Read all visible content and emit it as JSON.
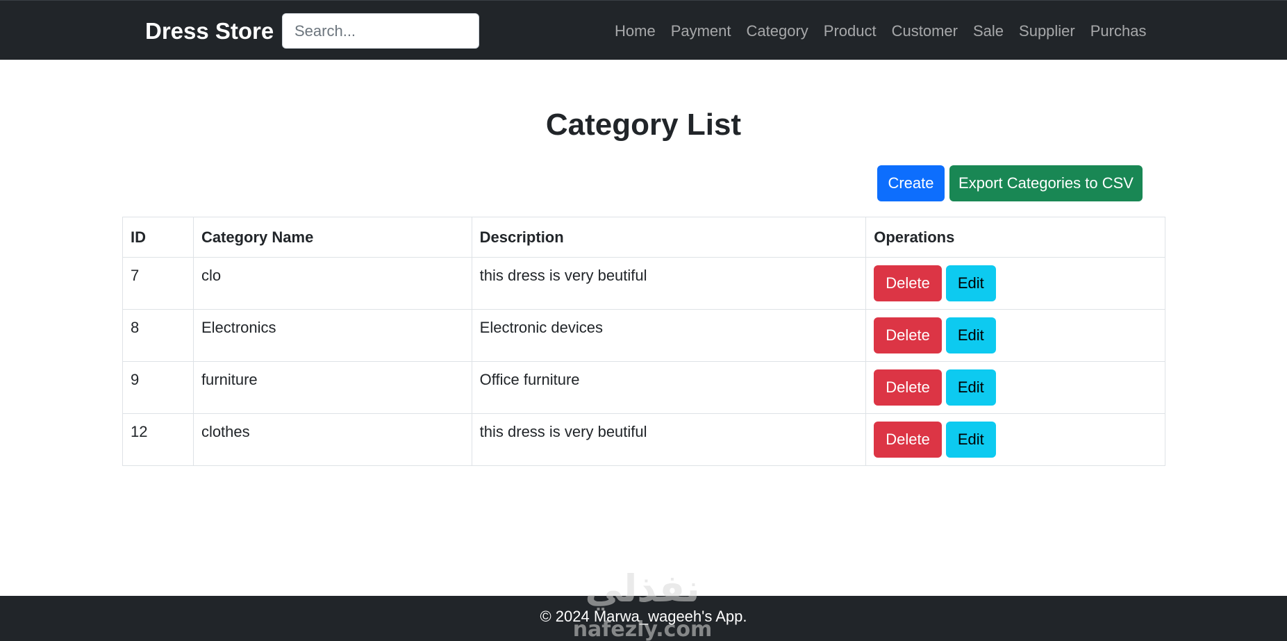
{
  "navbar": {
    "brand": "Dress Store",
    "search_placeholder": "Search...",
    "links": [
      "Home",
      "Payment",
      "Category",
      "Product",
      "Customer",
      "Sale",
      "Supplier",
      "Purchas"
    ]
  },
  "page": {
    "title": "Category List",
    "create_label": "Create",
    "export_label": "Export Categories to CSV"
  },
  "table": {
    "headers": [
      "ID",
      "Category Name",
      "Description",
      "Operations"
    ],
    "rows": [
      {
        "id": "7",
        "name": "clo",
        "description": "this dress is very beutiful"
      },
      {
        "id": "8",
        "name": "Electronics",
        "description": "Electronic devices"
      },
      {
        "id": "9",
        "name": "furniture",
        "description": "Office furniture"
      },
      {
        "id": "12",
        "name": "clothes",
        "description": "this dress is very beutiful"
      }
    ],
    "delete_label": "Delete",
    "edit_label": "Edit"
  },
  "footer": {
    "text": "© 2024 Marwa_wageeh's App."
  },
  "watermark": {
    "arabic": "نفذلي",
    "latin": "nafezly.com"
  },
  "colors": {
    "navbar": "#212529",
    "primary": "#0d6efd",
    "success": "#198754",
    "danger": "#dc3545",
    "info": "#0dcaf0"
  }
}
